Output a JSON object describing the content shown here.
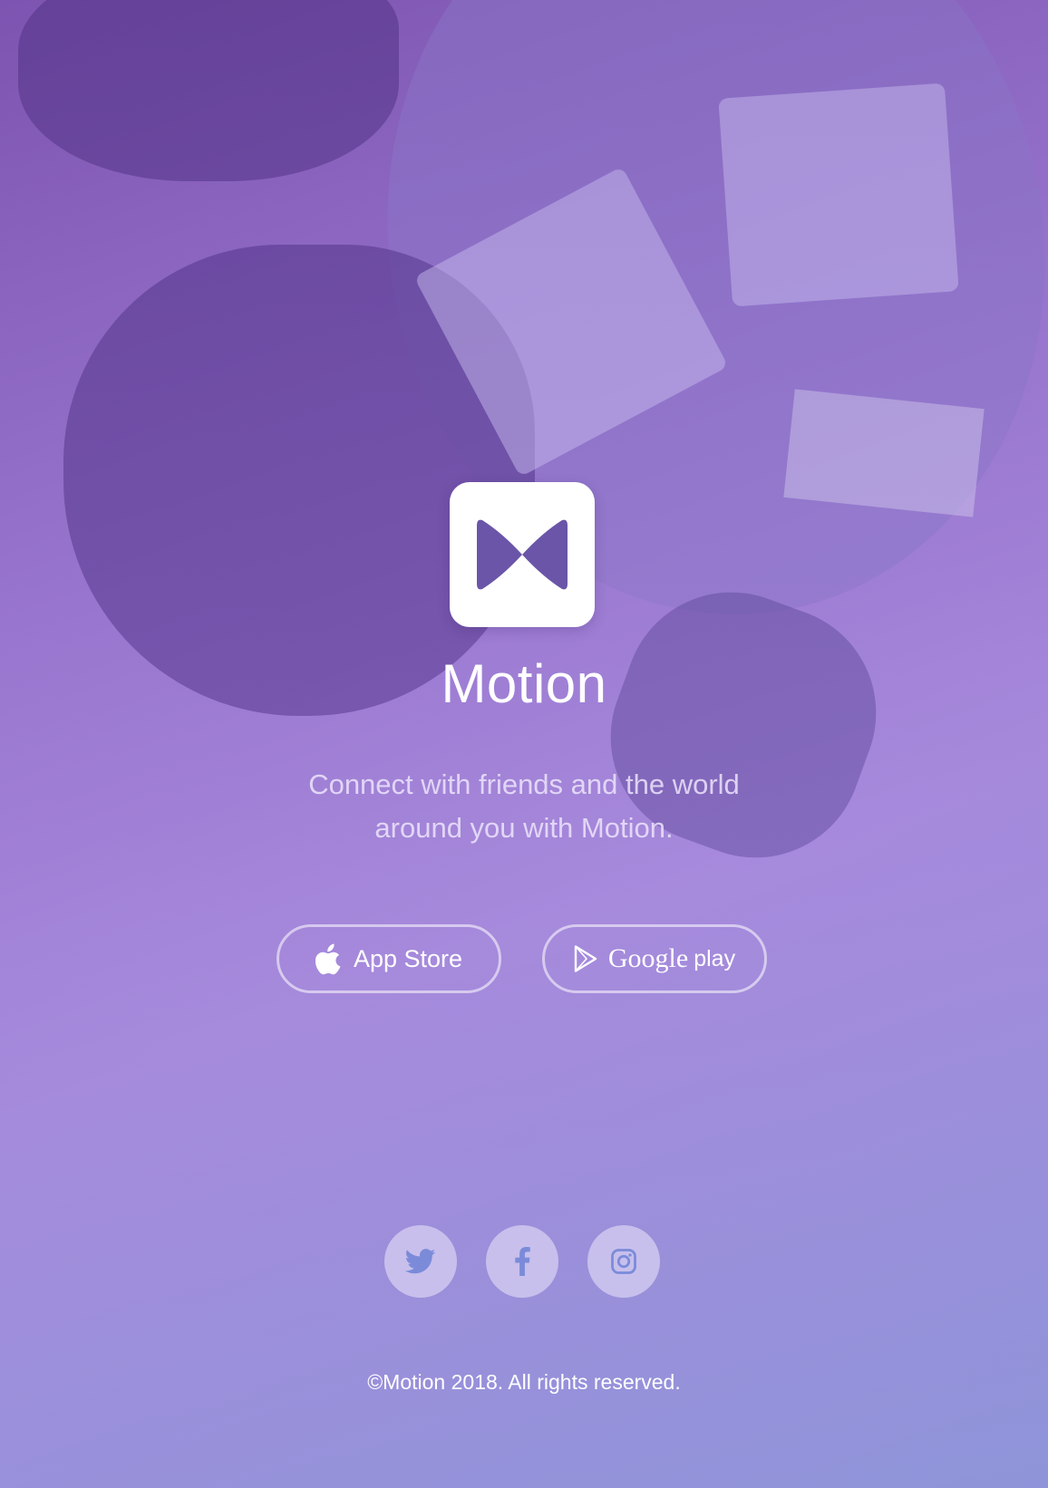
{
  "app": {
    "name": "Motion",
    "tagline": "Connect with friends and the world around you with Motion."
  },
  "store_buttons": {
    "apple_label": "App Store",
    "google_label": "Google",
    "google_suffix": "play"
  },
  "social": [
    {
      "name": "twitter",
      "icon": "twitter-icon"
    },
    {
      "name": "facebook",
      "icon": "facebook-icon"
    },
    {
      "name": "instagram",
      "icon": "instagram-icon"
    }
  ],
  "footer": {
    "copyright": "©Motion 2018. All rights reserved."
  },
  "colors": {
    "logo_mark": "#6a55a8",
    "social_icon": "#7b8bd9",
    "text": "#ffffff"
  }
}
